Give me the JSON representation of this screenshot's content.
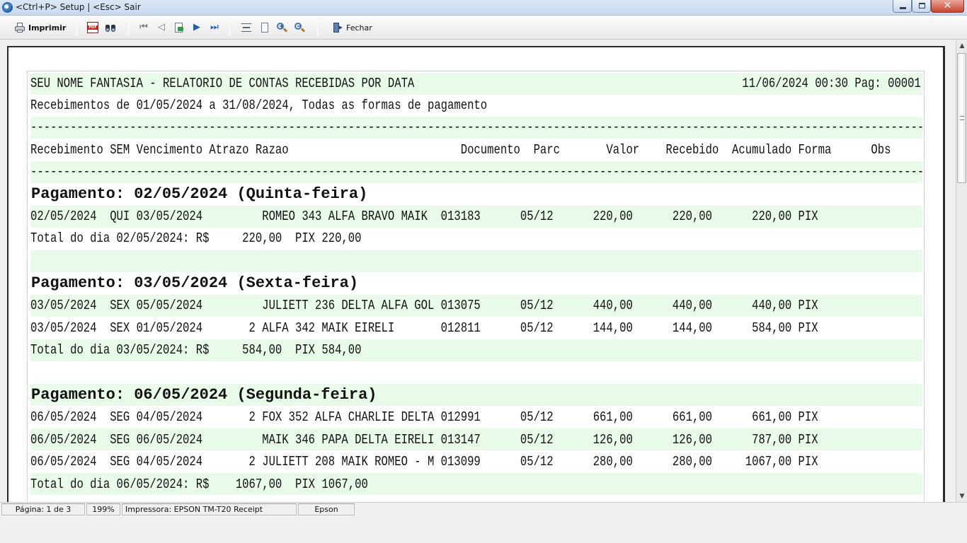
{
  "window": {
    "title": "<Ctrl+P> Setup | <Esc> Sair",
    "minimize_icon": "minimize-icon",
    "maximize_icon": "maximize-icon",
    "close_glyph": "✕"
  },
  "toolbar": {
    "print_label": "Imprimir",
    "close_label": "Fechar",
    "pdf_badge": "PDF",
    "nav_first": "⏮",
    "nav_prev": "◁",
    "nav_next": "▶",
    "nav_last": "⏭",
    "zoom_in_sign": "+",
    "zoom_out_sign": "−"
  },
  "report": {
    "header_left": "SEU NOME FANTASIA - RELATORIO DE CONTAS RECEBIDAS POR DATA",
    "header_right": "11/06/2024 00:30 Pag: 00001",
    "subtitle": "Recebimentos de 01/05/2024 a 31/08/2024, Todas as formas de pagamento",
    "separator": "-----------------------------------------------------------------------------------------------------------------------------------------------------------------",
    "columns": [
      "Recebimento",
      "SEM",
      "Vencimento",
      "Atrazo",
      "Razao",
      "Documento",
      "Parc",
      "Valor",
      "Recebido",
      "Acumulado",
      "Forma",
      "Obs"
    ],
    "columns_line": "Recebimento SEM Vencimento Atrazo Razao                          Documento  Parc       Valor    Recebido  Acumulado Forma      Obs",
    "groups": [
      {
        "heading": "Pagamento: 02/05/2024 (Quinta-feira)",
        "rows": [
          "02/05/2024  QUI 03/05/2024         ROMEO 343 ALFA BRAVO MAIK  013183      05/12      220,00      220,00      220,00 PIX"
        ],
        "total": "Total do dia 02/05/2024: R$     220,00  PIX 220,00"
      },
      {
        "heading": "Pagamento: 03/05/2024 (Sexta-feira)",
        "rows": [
          "03/05/2024  SEX 05/05/2024         JULIETT 236 DELTA ALFA GOL 013075      05/12      440,00      440,00      440,00 PIX",
          "03/05/2024  SEX 01/05/2024       2 ALFA 342 MAIK EIRELI       012811      05/12      144,00      144,00      584,00 PIX"
        ],
        "total": "Total do dia 03/05/2024: R$     584,00  PIX 584,00"
      },
      {
        "heading": "Pagamento: 06/05/2024 (Segunda-feira)",
        "rows": [
          "06/05/2024  SEG 04/05/2024       2 FOX 352 ALFA CHARLIE DELTA 012991      05/12      661,00      661,00      661,00 PIX",
          "06/05/2024  SEG 06/05/2024         MAIK 346 PAPA DELTA EIRELI 013147      05/12      126,00      126,00      787,00 PIX",
          "06/05/2024  SEG 04/05/2024       2 JULIETT 208 MAIK ROMEO - M 013099      05/12      280,00      280,00     1067,00 PIX"
        ],
        "total": "Total do dia 06/05/2024: R$    1067,00  PIX 1067,00"
      }
    ]
  },
  "statusbar": {
    "page": "Página: 1 de 3",
    "zoom": "199%",
    "printer": "Impressora: EPSON TM-T20 Receipt",
    "port": "Epson"
  },
  "colors": {
    "stripe": "#e8fbe8",
    "titlebar": "#c9d9ee",
    "close_button": "#c8432c"
  }
}
